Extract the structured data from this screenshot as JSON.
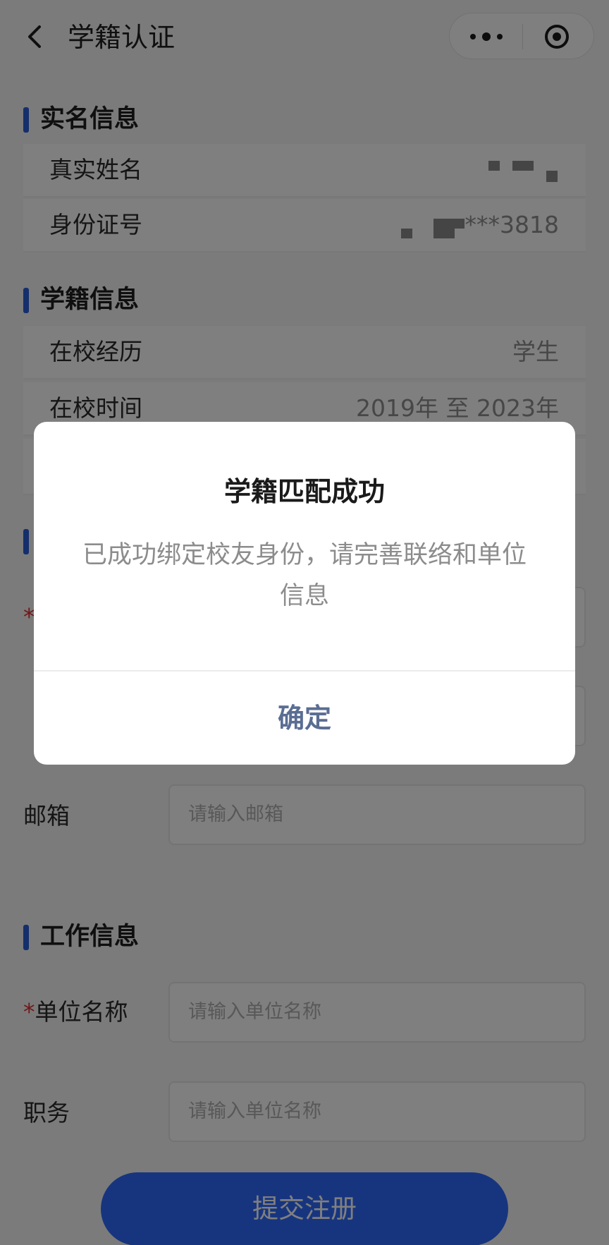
{
  "header": {
    "title": "学籍认证",
    "back_icon": "chevron-left-icon",
    "more_icon": "more-dots-icon",
    "close_icon": "target-circle-icon"
  },
  "real_name_section": {
    "title": "实名信息",
    "rows": [
      {
        "label": "真实姓名",
        "value": ""
      },
      {
        "label": "身份证号",
        "value": "***3818"
      }
    ]
  },
  "school_section": {
    "title": "学籍信息",
    "rows": [
      {
        "label": "在校经历",
        "value": "学生"
      },
      {
        "label": "在校时间",
        "value": "2019年 至 2023年"
      }
    ]
  },
  "contact_section": {
    "email_label": "邮箱",
    "email_placeholder": "请输入邮箱"
  },
  "work_section": {
    "title": "工作信息",
    "company_required_mark": "*",
    "company_label": "单位名称",
    "company_placeholder": "请输入单位名称",
    "position_label": "职务",
    "position_placeholder": "请输入单位名称"
  },
  "submit_label": "提交注册",
  "colors": {
    "accent": "#2b5fd9",
    "button": "#2f6bff",
    "required": "#e03131",
    "modal_confirm": "#5a6d93"
  },
  "modal": {
    "title": "学籍匹配成功",
    "message": "已成功绑定校友身份，请完善联络和单位信息",
    "confirm_label": "确定"
  }
}
